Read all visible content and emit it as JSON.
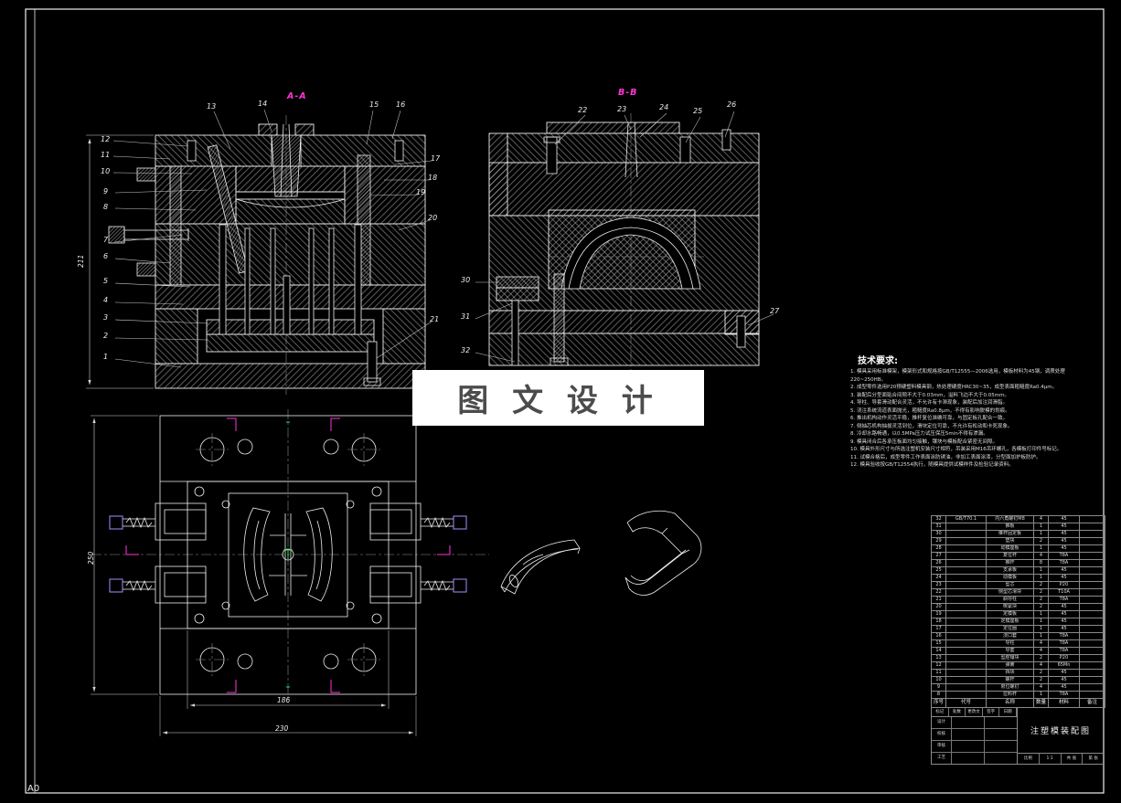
{
  "sheet": {
    "format": "A0",
    "watermark": "图 文 设 计"
  },
  "section_a": {
    "label": "A-A",
    "dim_height": "211",
    "top": [
      "13",
      "14",
      "15",
      "16"
    ],
    "left": [
      "12",
      "11",
      "10",
      "9",
      "8",
      "7",
      "6",
      "5",
      "4",
      "3",
      "2",
      "1"
    ],
    "right": [
      "17",
      "18",
      "19",
      "20",
      "21"
    ]
  },
  "section_b": {
    "label": "B-B",
    "top": [
      "22",
      "23",
      "24",
      "25",
      "26"
    ],
    "right": [
      "27"
    ],
    "left": [
      "30",
      "31",
      "32"
    ]
  },
  "plan": {
    "dim_height": "250",
    "dim_inner": "186",
    "dim_outer": "230"
  },
  "tech": {
    "title": "技术要求:",
    "items": [
      "1. 模具采用标准模架，模架形式和规格按GB/T12555—2006选用，模板材料为45钢，调质处理220~250HB。",
      "2. 成型零件选用P20预硬塑料模具钢，热处理硬度HRC30~35，成型表面粗糙度Ra0.4μm。",
      "3. 装配后分型面贴合间隙不大于0.03mm，溢料飞边不大于0.05mm。",
      "4. 导柱、导套滑动配合灵活，不允许有卡滞现象，装配后加注润滑脂。",
      "5. 浇注系统流道表面抛光，粗糙度Ra0.8μm，不得有影响脱模的划痕。",
      "6. 推出机构动作灵活平稳，推杆复位准确可靠，与固定板孔配合一致。",
      "7. 侧抽芯机构抽拔灵活到位，滑块定位可靠，不允许有松动和卡死现象。",
      "8. 冷却水路畅通，以0.5MPa压力试压保压5min不得有渗漏。",
      "9. 模具闭合后各承压板面均匀接触，镶块与模板配合紧密无间隙。",
      "10. 模具外形尺寸与所选注塑机安装尺寸相符，吊装采用M16吊环螺孔，各模板打印件号标记。",
      "11. 试模合格后，成型零件工作表面涂防锈油，非加工表面涂漆，分型面加护板防护。",
      "12. 模具验收按GB/T12554执行，随模具提供试模样件及检验记录资料。"
    ]
  },
  "bom": {
    "headers": [
      "序号",
      "代号",
      "名称",
      "数量",
      "材料",
      "备注"
    ],
    "rows": [
      {
        "no": "32",
        "code": "GB/T70.1",
        "name": "内六角螺钉M8",
        "qty": "4",
        "mat": "45",
        "note": ""
      },
      {
        "no": "31",
        "code": "",
        "name": "推板",
        "qty": "1",
        "mat": "45",
        "note": ""
      },
      {
        "no": "30",
        "code": "",
        "name": "推杆固定板",
        "qty": "1",
        "mat": "45",
        "note": ""
      },
      {
        "no": "29",
        "code": "",
        "name": "垫块",
        "qty": "2",
        "mat": "45",
        "note": ""
      },
      {
        "no": "28",
        "code": "",
        "name": "动模座板",
        "qty": "1",
        "mat": "45",
        "note": ""
      },
      {
        "no": "27",
        "code": "",
        "name": "复位杆",
        "qty": "4",
        "mat": "T8A",
        "note": ""
      },
      {
        "no": "26",
        "code": "",
        "name": "推杆",
        "qty": "8",
        "mat": "T8A",
        "note": ""
      },
      {
        "no": "25",
        "code": "",
        "name": "支承板",
        "qty": "1",
        "mat": "45",
        "note": ""
      },
      {
        "no": "24",
        "code": "",
        "name": "动模板",
        "qty": "1",
        "mat": "45",
        "note": ""
      },
      {
        "no": "23",
        "code": "",
        "name": "型芯",
        "qty": "2",
        "mat": "P20",
        "note": ""
      },
      {
        "no": "22",
        "code": "",
        "name": "侧型芯滑块",
        "qty": "2",
        "mat": "T10A",
        "note": ""
      },
      {
        "no": "21",
        "code": "",
        "name": "斜导柱",
        "qty": "2",
        "mat": "T8A",
        "note": ""
      },
      {
        "no": "20",
        "code": "",
        "name": "楔紧块",
        "qty": "2",
        "mat": "45",
        "note": ""
      },
      {
        "no": "19",
        "code": "",
        "name": "定模板",
        "qty": "1",
        "mat": "45",
        "note": ""
      },
      {
        "no": "18",
        "code": "",
        "name": "定模座板",
        "qty": "1",
        "mat": "45",
        "note": ""
      },
      {
        "no": "17",
        "code": "",
        "name": "定位圈",
        "qty": "1",
        "mat": "45",
        "note": ""
      },
      {
        "no": "16",
        "code": "",
        "name": "浇口套",
        "qty": "1",
        "mat": "T8A",
        "note": ""
      },
      {
        "no": "15",
        "code": "",
        "name": "导柱",
        "qty": "4",
        "mat": "T8A",
        "note": ""
      },
      {
        "no": "14",
        "code": "",
        "name": "导套",
        "qty": "4",
        "mat": "T8A",
        "note": ""
      },
      {
        "no": "13",
        "code": "",
        "name": "型腔镶块",
        "qty": "2",
        "mat": "P20",
        "note": ""
      },
      {
        "no": "12",
        "code": "",
        "name": "弹簧",
        "qty": "4",
        "mat": "65Mn",
        "note": ""
      },
      {
        "no": "11",
        "code": "",
        "name": "挡块",
        "qty": "2",
        "mat": "45",
        "note": ""
      },
      {
        "no": "10",
        "code": "",
        "name": "螺杆",
        "qty": "2",
        "mat": "45",
        "note": ""
      },
      {
        "no": "9",
        "code": "",
        "name": "限位螺钉",
        "qty": "4",
        "mat": "45",
        "note": ""
      },
      {
        "no": "8",
        "code": "",
        "name": "拉料杆",
        "qty": "1",
        "mat": "T8A",
        "note": ""
      }
    ]
  },
  "titleblock": {
    "title": "注塑模装配图",
    "row1": [
      "标记",
      "处数",
      "更改文件号",
      "签字",
      "日期"
    ],
    "design": "设计",
    "check": "校核",
    "audit": "审核",
    "craft": "工艺",
    "scale_label": "比例",
    "scale": "1:1",
    "count_label": "共 张",
    "page_label": "第 张"
  }
}
